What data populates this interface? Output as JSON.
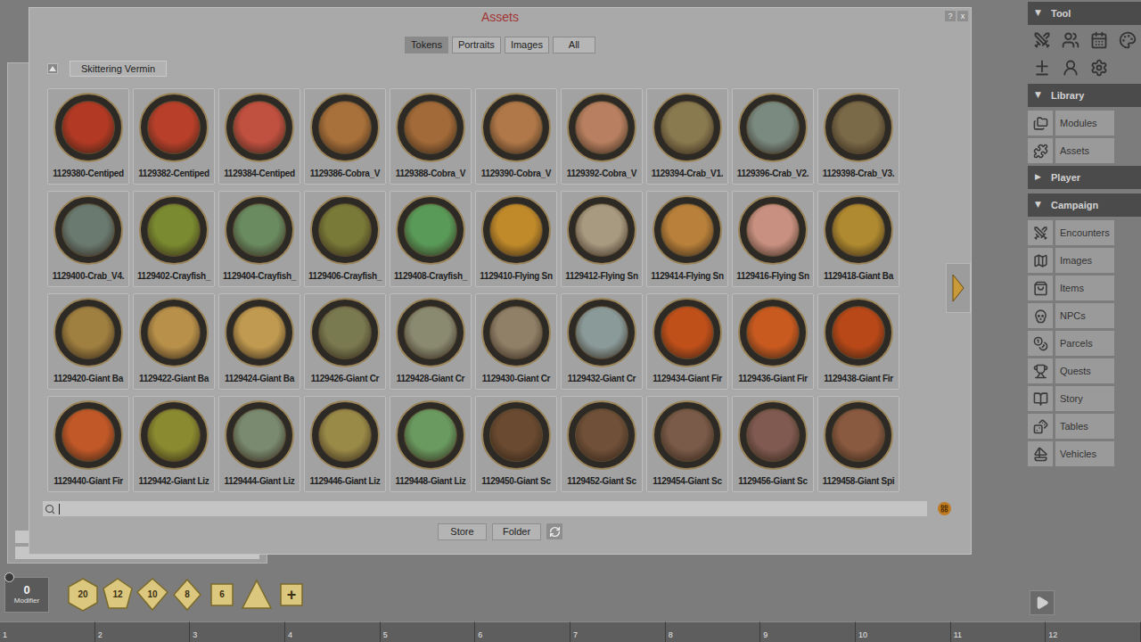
{
  "window": {
    "title": "Assets",
    "help": "?",
    "close": "x"
  },
  "tabs": [
    {
      "label": "Tokens",
      "selected": true
    },
    {
      "label": "Portraits",
      "selected": false
    },
    {
      "label": "Images",
      "selected": false
    },
    {
      "label": "All",
      "selected": false
    }
  ],
  "folder": {
    "path": "Skittering Vermin"
  },
  "tokens": [
    {
      "label": "1129380-Centiped",
      "color": "#b23a24"
    },
    {
      "label": "1129382-Centiped",
      "color": "#b8402a"
    },
    {
      "label": "1129384-Centiped",
      "color": "#c05040"
    },
    {
      "label": "1129386-Cobra_V",
      "color": "#a8703a"
    },
    {
      "label": "1129388-Cobra_V",
      "color": "#a26a38"
    },
    {
      "label": "1129390-Cobra_V",
      "color": "#b07848"
    },
    {
      "label": "1129392-Cobra_V",
      "color": "#b88060"
    },
    {
      "label": "1129394-Crab_V1.",
      "color": "#8a7a50"
    },
    {
      "label": "1129396-Crab_V2.",
      "color": "#7a8a80"
    },
    {
      "label": "1129398-Crab_V3.",
      "color": "#7a6a48"
    },
    {
      "label": "1129400-Crab_V4.",
      "color": "#6a7a70"
    },
    {
      "label": "1129402-Crayfish_",
      "color": "#7a8a30"
    },
    {
      "label": "1129404-Crayfish_",
      "color": "#6a8a60"
    },
    {
      "label": "1129406-Crayfish_",
      "color": "#7a7a38"
    },
    {
      "label": "1129408-Crayfish_",
      "color": "#5a9a58"
    },
    {
      "label": "1129410-Flying Sn",
      "color": "#c08a2a"
    },
    {
      "label": "1129412-Flying Sn",
      "color": "#a89a80"
    },
    {
      "label": "1129414-Flying Sn",
      "color": "#b8803a"
    },
    {
      "label": "1129416-Flying Sn",
      "color": "#c89080"
    },
    {
      "label": "1129418-Giant Ba",
      "color": "#b08a30"
    },
    {
      "label": "1129420-Giant Ba",
      "color": "#a08040"
    },
    {
      "label": "1129422-Giant Ba",
      "color": "#b8904a"
    },
    {
      "label": "1129424-Giant Ba",
      "color": "#c09a50"
    },
    {
      "label": "1129426-Giant Cr",
      "color": "#7a7a50"
    },
    {
      "label": "1129428-Giant Cr",
      "color": "#8a8a70"
    },
    {
      "label": "1129430-Giant Cr",
      "color": "#908068"
    },
    {
      "label": "1129432-Giant Cr",
      "color": "#8a9a98"
    },
    {
      "label": "1129434-Giant Fir",
      "color": "#c0501a"
    },
    {
      "label": "1129436-Giant Fir",
      "color": "#c85a20"
    },
    {
      "label": "1129438-Giant Fir",
      "color": "#b84818"
    },
    {
      "label": "1129440-Giant Fir",
      "color": "#c05828"
    },
    {
      "label": "1129442-Giant Liz",
      "color": "#8a8a30"
    },
    {
      "label": "1129444-Giant Liz",
      "color": "#7a8a70"
    },
    {
      "label": "1129446-Giant Liz",
      "color": "#9a8a48"
    },
    {
      "label": "1129448-Giant Liz",
      "color": "#6a9a60"
    },
    {
      "label": "1129450-Giant Sc",
      "color": "#6a4a30"
    },
    {
      "label": "1129452-Giant Sc",
      "color": "#705038"
    },
    {
      "label": "1129454-Giant Sc",
      "color": "#7a5a48"
    },
    {
      "label": "1129456-Giant Sc",
      "color": "#805a50"
    },
    {
      "label": "1129458-Giant Spi",
      "color": "#8a5a40"
    }
  ],
  "search": {
    "value": "",
    "focused": true
  },
  "buttons": [
    "Store",
    "Folder"
  ],
  "sidebar": {
    "sections": [
      {
        "title": "Tool",
        "toggle": "▼",
        "expanded": true,
        "kind": "icons",
        "items": []
      },
      {
        "title": "Library",
        "toggle": "▼",
        "expanded": true,
        "kind": "list",
        "items": [
          "Modules",
          "Assets"
        ]
      },
      {
        "title": "Player",
        "toggle": "▶",
        "expanded": false,
        "kind": "list",
        "items": []
      },
      {
        "title": "Campaign",
        "toggle": "▼",
        "expanded": true,
        "kind": "list",
        "items": [
          "Encounters",
          "Images",
          "Items",
          "NPCs",
          "Parcels",
          "Quests",
          "Story",
          "Tables",
          "Vehicles"
        ]
      }
    ]
  },
  "modifier": {
    "value": "0",
    "label": "Modifier"
  },
  "dice": [
    {
      "label": "20",
      "kind": "d20"
    },
    {
      "label": "12",
      "kind": "d12"
    },
    {
      "label": "10",
      "kind": "d10"
    },
    {
      "label": "8",
      "kind": "d8"
    },
    {
      "label": "6",
      "kind": "d6"
    },
    {
      "label": "",
      "kind": "d4"
    },
    {
      "label": "+",
      "kind": "add"
    }
  ],
  "hotkeys": [
    "1",
    "2",
    "3",
    "4",
    "5",
    "6",
    "7",
    "8",
    "9",
    "10",
    "11",
    "12"
  ]
}
